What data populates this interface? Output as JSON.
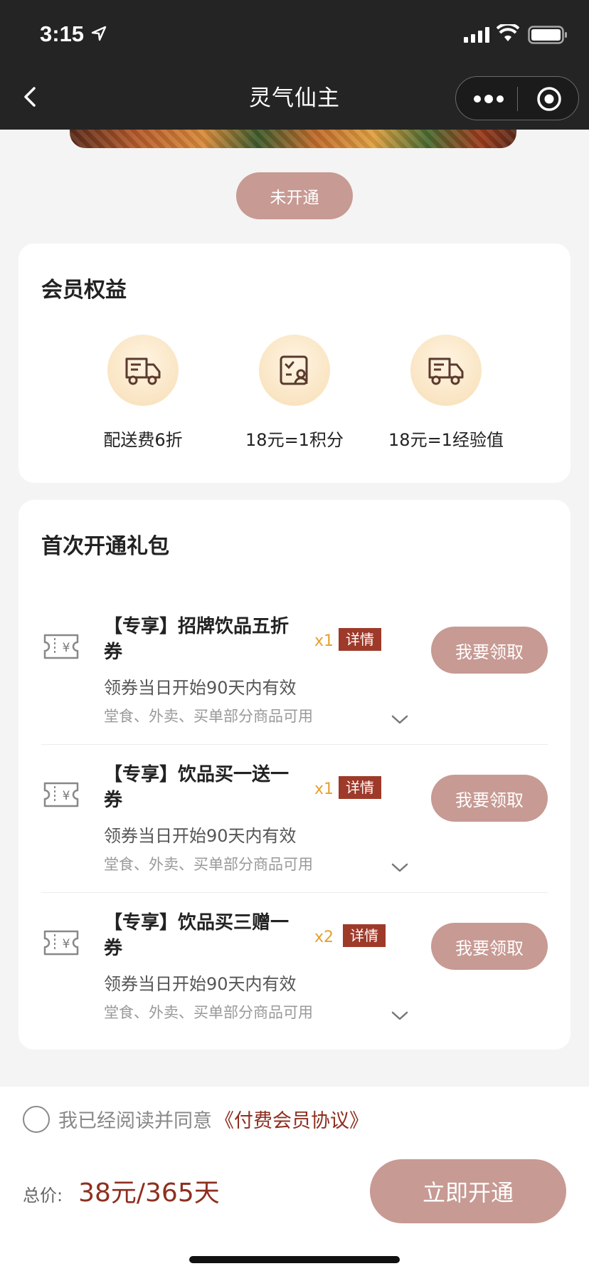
{
  "status_bar": {
    "time": "3:15"
  },
  "nav": {
    "title": "灵气仙主"
  },
  "membership_status": "未开通",
  "benefits": {
    "title": "会员权益",
    "items": [
      {
        "label": "配送费6折",
        "icon": "delivery-truck-icon"
      },
      {
        "label": "18元=1积分",
        "icon": "points-card-icon"
      },
      {
        "label": "18元=1经验值",
        "icon": "delivery-truck-icon"
      }
    ]
  },
  "gift": {
    "title": "首次开通礼包",
    "coupons": [
      {
        "name": "【专享】招牌饮品五折券",
        "qty": "x1",
        "detail": "详情",
        "valid": "领券当日开始90天内有效",
        "scope": "堂食、外卖、买单部分商品可用",
        "claim": "我要领取"
      },
      {
        "name": "【专享】饮品买一送一券",
        "qty": "x1",
        "detail": "详情",
        "valid": "领券当日开始90天内有效",
        "scope": "堂食、外卖、买单部分商品可用",
        "claim": "我要领取"
      },
      {
        "name": "【专享】饮品买三赠一券",
        "qty": "x2",
        "detail": "详情",
        "valid": "领券当日开始90天内有效",
        "scope": "堂食、外卖、买单部分商品可用",
        "claim": "我要领取"
      }
    ]
  },
  "footer": {
    "agree_text": "我已经阅读并同意",
    "agreement_link": "《付费会员协议》",
    "total_label": "总价:",
    "price": "38元/365天",
    "open_button": "立即开通"
  },
  "colors": {
    "accent": "#c79a93",
    "brand_dark": "#8e2f20",
    "qty": "#e6a12e",
    "detail_tag": "#9e3a2a"
  }
}
